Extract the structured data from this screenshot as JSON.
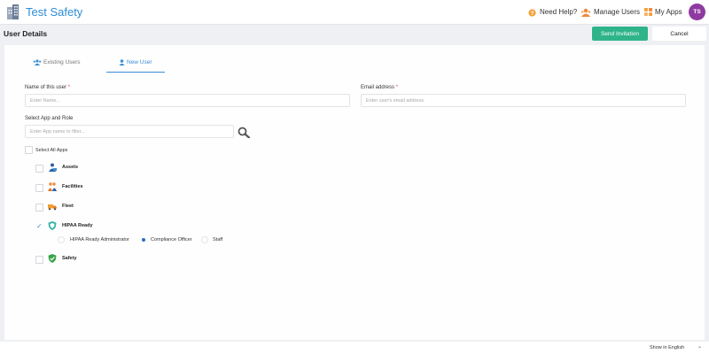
{
  "header": {
    "app_title": "Test Safety",
    "nav": [
      {
        "label": "Need Help?",
        "icon": "help-circle-icon"
      },
      {
        "label": "Manage Users",
        "icon": "manage-users-icon"
      },
      {
        "label": "My Apps",
        "icon": "apps-grid-icon"
      }
    ],
    "avatar_initials": "TS",
    "avatar_color": "#8e3aa0",
    "accent_color": "#2b8dd6"
  },
  "subheader": {
    "title": "User Details",
    "send_label": "Send Invitation",
    "cancel_label": "Cancel",
    "send_color": "#2fb48a"
  },
  "tabs": [
    {
      "label": "Existing Users",
      "active": false
    },
    {
      "label": "New User",
      "active": true
    }
  ],
  "form": {
    "name_label": "Name of this user",
    "name_placeholder": "Enter Name...",
    "email_label": "Email address",
    "email_placeholder": "Enter user's email address.",
    "required_mark": "*",
    "app_role_label": "Select App and Role",
    "filter_placeholder": "Enter App name to filter...",
    "select_all_label": "Select All Apps"
  },
  "apps": [
    {
      "name": "Assets",
      "checked": false
    },
    {
      "name": "Facilities",
      "checked": false
    },
    {
      "name": "Fleet",
      "checked": false
    },
    {
      "name": "HIPAA Ready",
      "checked": true
    },
    {
      "name": "Safety",
      "checked": false
    }
  ],
  "hipaa_roles": [
    {
      "label": "HIPAA Ready Administrator",
      "selected": false
    },
    {
      "label": "Compliance Officer",
      "selected": true
    },
    {
      "label": "Staff",
      "selected": false
    }
  ],
  "footer": {
    "language_label": "Show in English"
  }
}
